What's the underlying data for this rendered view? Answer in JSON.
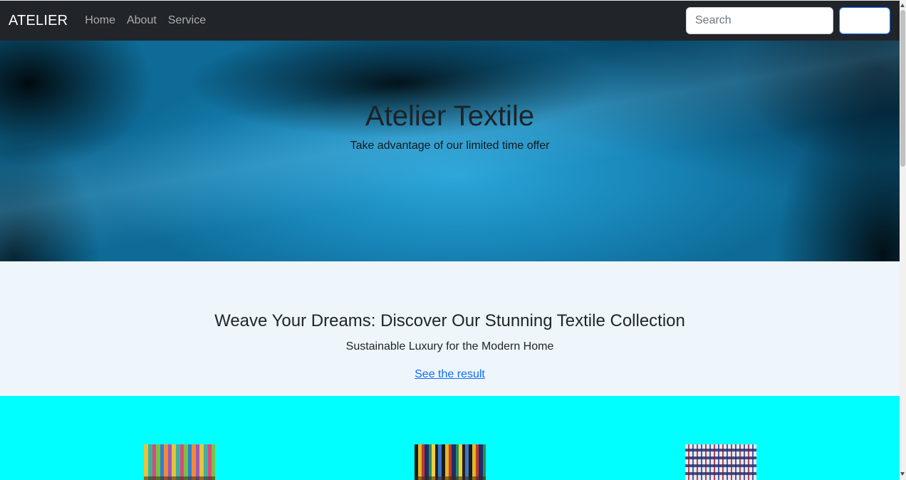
{
  "navbar": {
    "brand": "ATELIER",
    "links": [
      {
        "label": "Home"
      },
      {
        "label": "About"
      },
      {
        "label": "Service"
      }
    ],
    "search": {
      "placeholder": "Search",
      "value": ""
    },
    "search_button_label": ""
  },
  "hero": {
    "title": "Atelier Textile",
    "subtitle": "Take advantage of our limited time offer"
  },
  "intro": {
    "title": "Weave Your Dreams: Discover Our Stunning Textile Collection",
    "subtitle": "Sustainable Luxury for the Modern Home",
    "link_label": "See the result"
  },
  "products": {
    "items": [
      {
        "image": "colorful-fabric-rolls-image"
      },
      {
        "image": "patterned-fabric-rolls-image"
      },
      {
        "image": "checked-fabric-stack-image"
      }
    ]
  },
  "colors": {
    "navbar_bg": "#212529",
    "accent": "#0d6efd",
    "intro_bg": "#eef5fb",
    "products_bg": "#00ffff",
    "hero_fabric": "#1886b8"
  }
}
